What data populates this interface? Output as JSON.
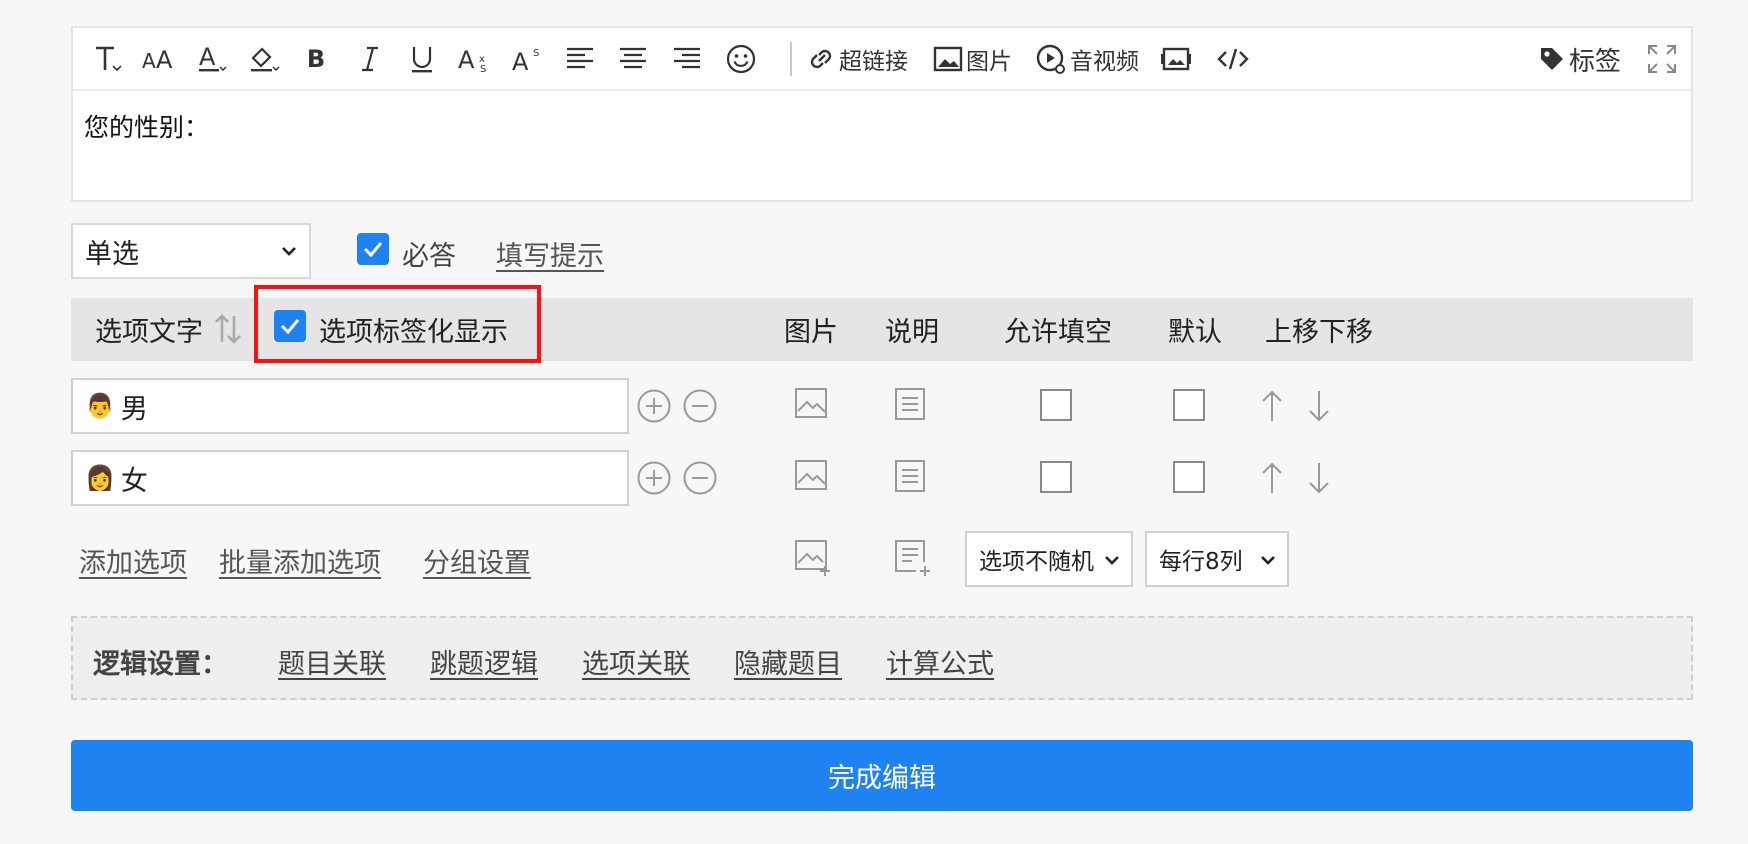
{
  "editor": {
    "toolbar": {
      "hyperlink_label": "超链接",
      "image_label": "图片",
      "media_label": "音视频",
      "tag_label": "标签"
    },
    "content": "您的性别："
  },
  "question": {
    "type_value": "单选",
    "required_label": "必答",
    "hint_link": "填写提示"
  },
  "header": {
    "option_text": "选项文字",
    "tagify_label": "选项标签化显示",
    "image": "图片",
    "description": "说明",
    "allow_fill": "允许填空",
    "default": "默认",
    "move": "上移下移"
  },
  "options": [
    {
      "emoji": "👨",
      "text": "男"
    },
    {
      "emoji": "👩",
      "text": "女"
    }
  ],
  "actions": {
    "add_option": "添加选项",
    "batch_add": "批量添加选项",
    "group_settings": "分组设置",
    "random_select": "选项不随机",
    "columns_select": "每行8列"
  },
  "logic": {
    "label": "逻辑设置：",
    "links": [
      "题目关联",
      "跳题逻辑",
      "选项关联",
      "隐藏题目",
      "计算公式"
    ]
  },
  "finish_button": "完成编辑",
  "colors": {
    "accent": "#1e82f0",
    "highlight": "#ff1010"
  }
}
